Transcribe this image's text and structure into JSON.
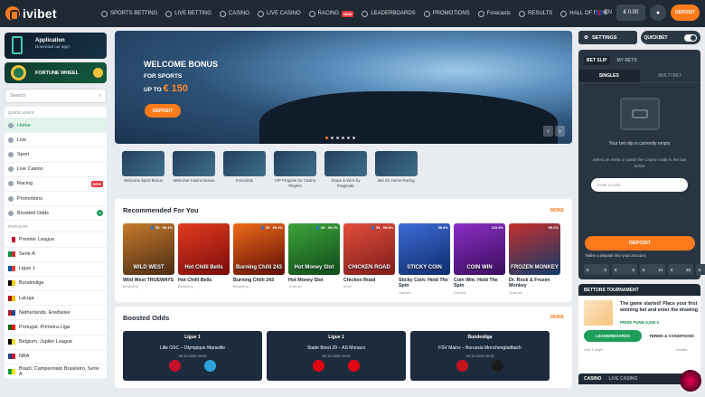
{
  "header": {
    "logo": "ivibet",
    "nav": [
      {
        "label": "SPORTS BETTING",
        "icon": "sports-icon"
      },
      {
        "label": "LIVE BETTING",
        "icon": "live-icon"
      },
      {
        "label": "CASINO",
        "icon": "casino-icon"
      },
      {
        "label": "LIVE CASINO",
        "icon": "live-casino-icon"
      },
      {
        "label": "RACING",
        "icon": "racing-icon",
        "badge": "NEW"
      },
      {
        "label": "LEADERBOARDS",
        "icon": "leaderboards-icon"
      },
      {
        "label": "PROMOTIONS",
        "icon": "promotions-icon"
      },
      {
        "label": "Forecasts",
        "icon": "forecasts-icon"
      },
      {
        "label": "RESULTS",
        "icon": "results-icon"
      },
      {
        "label": "HALL OF FAME",
        "icon": "hall-of-fame-icon"
      }
    ],
    "language": "EN",
    "balance": "€ 0.00",
    "deposit": "DEPOSIT"
  },
  "sidebar": {
    "app_title": "Application",
    "app_subtitle": "Download our app!",
    "fortune_wheel": "FORTUNE WHEEL",
    "search_placeholder": "Search",
    "quick_links_title": "QUICK LINKS",
    "quick_links": [
      {
        "label": "Home",
        "active": true
      },
      {
        "label": "Live"
      },
      {
        "label": "Sport"
      },
      {
        "label": "Live Casino"
      },
      {
        "label": "Racing",
        "badge": "NEW"
      },
      {
        "label": "Promotions"
      },
      {
        "label": "Boosted Odds",
        "count": "6"
      }
    ],
    "popular_title": "POPULAR",
    "popular": [
      {
        "label": "Premier League",
        "colors": [
          "#ffffff",
          "#c8102e"
        ]
      },
      {
        "label": "Serie A",
        "colors": [
          "#009246",
          "#ce2b37"
        ]
      },
      {
        "label": "Ligue 1",
        "colors": [
          "#0055a4",
          "#ef4135"
        ]
      },
      {
        "label": "Bundesliga",
        "colors": [
          "#000000",
          "#ffce00"
        ]
      },
      {
        "label": "LaLiga",
        "colors": [
          "#aa151b",
          "#f1bf00"
        ]
      },
      {
        "label": "Netherlands. Eredivisie",
        "colors": [
          "#ae1c28",
          "#21468b"
        ]
      },
      {
        "label": "Portugal. Primeira Liga",
        "colors": [
          "#006600",
          "#ff0000"
        ]
      },
      {
        "label": "Belgium. Jupiler League",
        "colors": [
          "#000000",
          "#fdda24"
        ]
      },
      {
        "label": "NBA",
        "colors": [
          "#1d428a",
          "#c8102e"
        ]
      },
      {
        "label": "Brazil. Campeonato Brasileiro. Serie A",
        "colors": [
          "#009c3b",
          "#ffdf00"
        ]
      }
    ]
  },
  "banner": {
    "title": "WELCOME BONUS",
    "subtitle": "FOR SPORTS",
    "amount_prefix": "UP TO",
    "amount": "€ 150",
    "button": "DEPOSIT"
  },
  "promos": [
    {
      "label": "Welcome Sport Bonus"
    },
    {
      "label": "Welcome Casino Bonus"
    },
    {
      "label": "Forecasts"
    },
    {
      "label": "VIP Program for Casino Players"
    },
    {
      "label": "Drops & Wins by Pragmatic"
    },
    {
      "label": "Bet On Horse Racing"
    }
  ],
  "recommended": {
    "title": "Recommended For You",
    "more": "MORE",
    "games": [
      {
        "name": "Wild West TRUEWAYS",
        "provider": "BGaming",
        "art": "WILD WEST",
        "players": "51",
        "rtp": "99.1%",
        "color1": "#4a2c14",
        "color2": "#c77b2c"
      },
      {
        "name": "Hot Chilli Bells",
        "provider": "BGaming",
        "art": "Hot Chilli Bells",
        "players": "",
        "rtp": "",
        "color1": "#7a0c0c",
        "color2": "#e23b1e"
      },
      {
        "name": "Burning Chilli 243",
        "provider": "BGaming",
        "art": "Burning Chilli 243",
        "players": "51",
        "rtp": "99.4%",
        "color1": "#5c0d05",
        "color2": "#f06b1a"
      },
      {
        "name": "Hot Money Slot",
        "provider": "TrueLab",
        "art": "Hot Money Slot",
        "players": "60",
        "rtp": "99.2%",
        "color1": "#0e4a1a",
        "color2": "#3fa43a"
      },
      {
        "name": "Chicken Road",
        "provider": "Inout",
        "art": "CHICKEN ROAD",
        "players": "51",
        "rtp": "99.5%",
        "color1": "#7e1b1b",
        "color2": "#e04e3a"
      },
      {
        "name": "Sticky Coin: Hold The Spin",
        "provider": "Gamzix",
        "art": "STICKY COIN",
        "players": "",
        "rtp": "98.8%",
        "color1": "#0e2d6b",
        "color2": "#3d6bd6"
      },
      {
        "name": "Coin Win: Hold The Spin",
        "provider": "Gamzix",
        "art": "COIN WIN",
        "players": "",
        "rtp": "110.3%",
        "color1": "#3b0d5c",
        "color2": "#8a2fc4"
      },
      {
        "name": "Dr. Rock & Frozen Monkey",
        "provider": "TrueLab",
        "art": "FROZEN MONKEY",
        "players": "",
        "rtp": "99.2%",
        "color1": "#0f3c6b",
        "color2": "#c62e2e"
      }
    ]
  },
  "boosted": {
    "title": "Boosted Odds",
    "more": "MORE",
    "matches": [
      {
        "league": "Ligue 1",
        "teams": "Lille OSC – Olympique Marseille",
        "date": "05.12.2025",
        "time": "20:00",
        "home_color": "#c8102e",
        "away_color": "#2fa4db"
      },
      {
        "league": "Ligue 1",
        "teams": "Stade Brest 29 – AS Monaco",
        "date": "05.12.2025",
        "time": "20:00",
        "home_color": "#e30613",
        "away_color": "#e30613"
      },
      {
        "league": "Bundesliga",
        "teams": "FSV Mainz – Borussia Monchengladbach",
        "date": "05.12.2025",
        "time": "20:30",
        "home_color": "#c3141e",
        "away_color": "#1b1b1b"
      }
    ]
  },
  "right": {
    "settings": "SETTINGS",
    "quickbet": "QUICKBET",
    "betslip_tab": "BET SLIP",
    "mybets_tab": "MY BETS",
    "singles": "SINGLES",
    "multibet": "MULTI BET",
    "empty": "Your bet slip is currently empty",
    "hint": "Select an event or paste the coupon code in the box below",
    "code_placeholder": "Enter a code",
    "deposit": "DEPOSIT",
    "note": "Make a deposit into your account",
    "amounts": [
      {
        "cur": "€",
        "val": "0"
      },
      {
        "cur": "€",
        "val": "5"
      },
      {
        "cur": "€",
        "val": "10"
      },
      {
        "cur": "€",
        "val": "20"
      },
      {
        "cur": "€",
        "val": "50"
      }
    ]
  },
  "tournament": {
    "title": "BETTORS TOURNAMENT",
    "text": "The game started! Place your first winning bet and enter the drawing",
    "prize_label": "PRIZE FUND",
    "prize": "6,000 €",
    "leaderboards": "LEADERBOARDS",
    "terms": "TERMS & CONDITIONS",
    "left": "Left: 2 days",
    "details": "Details"
  },
  "bottom": {
    "casino": "CASINO",
    "live_casino": "LIVE CASINO"
  }
}
